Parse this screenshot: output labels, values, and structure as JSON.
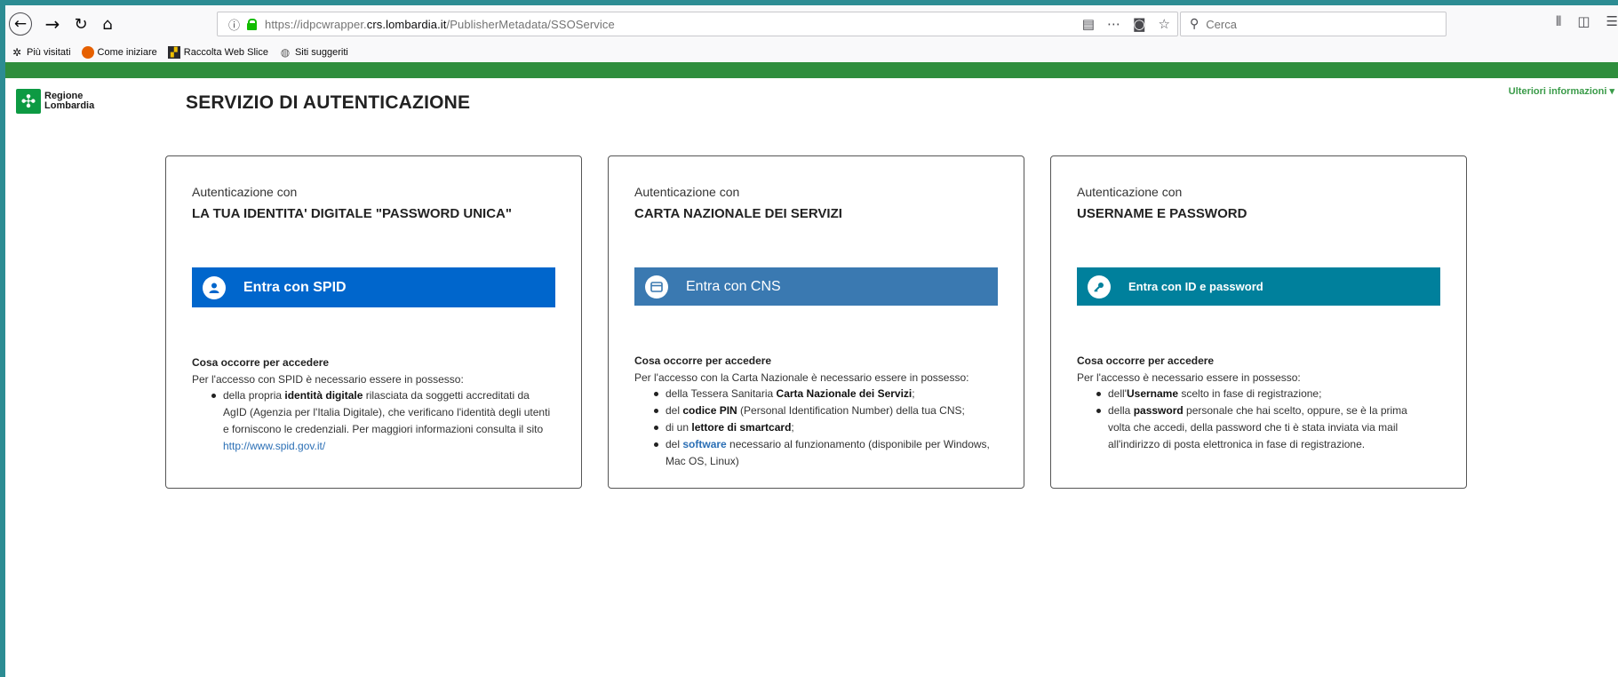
{
  "browser": {
    "url_scheme": "https://idpcwrapper.",
    "url_host": "crs.lombardia.it",
    "url_path": "/PublisherMetadata/SSOService",
    "search_placeholder": "Cerca",
    "bookmarks": [
      {
        "label": "Più visitati",
        "icon": "gear-icon"
      },
      {
        "label": "Come iniziare",
        "icon": "firefox-icon"
      },
      {
        "label": "Raccolta Web Slice",
        "icon": "webslice-icon"
      },
      {
        "label": "Siti suggeriti",
        "icon": "globe-icon"
      }
    ]
  },
  "header": {
    "logo_line1": "Regione",
    "logo_line2": "Lombardia",
    "title": "SERVIZIO DI AUTENTICAZIONE",
    "more_info": "Ulteriori informazioni ▾"
  },
  "cards": [
    {
      "pre": "Autenticazione con",
      "title": "LA TUA IDENTITA' DIGITALE \"PASSWORD UNICA\"",
      "button": "Entra con SPID",
      "button_color": "#0066cc",
      "req_title": "Cosa occorre per accedere",
      "req_intro": "Per l'accesso con SPID è necessario essere in possesso:",
      "items": [
        {
          "a": "della propria ",
          "b": "identità digitale",
          "c": " rilasciata da soggetti accreditati da AgID (Agenzia per l'Italia Digitale), che verificano l'identità degli utenti e forniscono le credenziali. Per maggiori informazioni consulta il sito ",
          "link": "http://www.spid.gov.it/"
        }
      ]
    },
    {
      "pre": "Autenticazione con",
      "title": "CARTA NAZIONALE DEI SERVIZI",
      "button": "Entra con CNS",
      "button_color": "#3a79b1",
      "req_title": "Cosa occorre per accedere",
      "req_intro": "Per l'accesso con la Carta Nazionale è necessario essere in possesso:",
      "items": [
        {
          "a": "della Tessera Sanitaria ",
          "b": "Carta Nazionale dei Servizi",
          "c": ";"
        },
        {
          "a": "del ",
          "b": "codice PIN",
          "c": " (Personal Identification Number) della tua CNS;"
        },
        {
          "a": "di un ",
          "b": "lettore di smartcard",
          "c": ";"
        },
        {
          "a": "del ",
          "sw": "software",
          "c": " necessario al funzionamento (disponibile per Windows, Mac OS, Linux)"
        }
      ]
    },
    {
      "pre": "Autenticazione con",
      "title": "USERNAME E PASSWORD",
      "button": "Entra con ID e password",
      "button_color": "#00809c",
      "req_title": "Cosa occorre per accedere",
      "req_intro": "Per l'accesso è necessario essere in possesso:",
      "items": [
        {
          "a": "dell'",
          "b": "Username",
          "c": " scelto in fase di registrazione;"
        },
        {
          "a": "della ",
          "b": "password",
          "c": " personale che hai scelto, oppure, se è la prima volta che accedi, della password che ti è stata inviata via mail all'indirizzo di posta elettronica in fase di registrazione."
        }
      ]
    }
  ]
}
